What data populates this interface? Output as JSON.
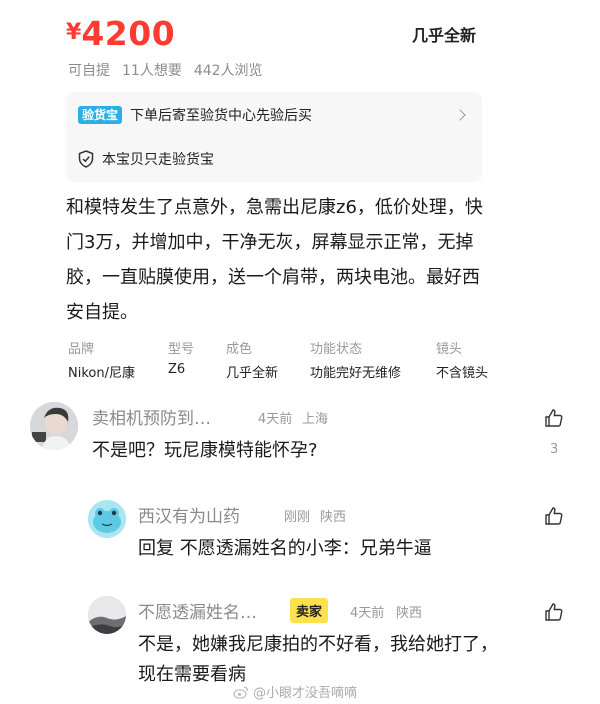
{
  "listing": {
    "currency": "¥",
    "price": "4200",
    "condition": "几乎全新",
    "meta": [
      "可自提",
      "11人想要",
      "442人浏览"
    ]
  },
  "inspection": {
    "badge": "验货宝",
    "text": "下单后寄至验货中心先验后买",
    "note": "本宝贝只走验货宝"
  },
  "description": "和模特发生了点意外，急需出尼康z6，低价处理，快门3万，并增加中，干净无灰，屏幕显示正常，无掉胶，一直贴膜使用，送一个肩带，两块电池。最好西安自提。",
  "specs": [
    {
      "k": "品牌",
      "v": "Nikon/尼康"
    },
    {
      "k": "型号",
      "v": "Z6"
    },
    {
      "k": "成色",
      "v": "几乎全新"
    },
    {
      "k": "功能状态",
      "v": "功能完好无维修"
    },
    {
      "k": "镜头",
      "v": "不含镜头"
    }
  ],
  "comments": [
    {
      "name": "卖相机预防到…",
      "time": "4天前",
      "location": "上海",
      "body": "不是吧？玩尼康模特能怀孕?",
      "likes": "3"
    },
    {
      "name": "西汉有为山药",
      "time": "刚刚",
      "location": "陕西",
      "body": "回复 不愿透漏姓名的小李：兄弟牛逼"
    },
    {
      "name": "不愿透漏姓名…",
      "badge": "卖家",
      "time": "4天前",
      "location": "陕西",
      "body": "不是，她嫌我尼康拍的不好看，我给她打了，现在需要看病"
    }
  ],
  "watermark": "@小眼才没吾嘀嘀",
  "colors": {
    "price": "#ff3b30",
    "badge_yellow": "#ffe14d",
    "yhb_blue": "#2ab0e6"
  }
}
